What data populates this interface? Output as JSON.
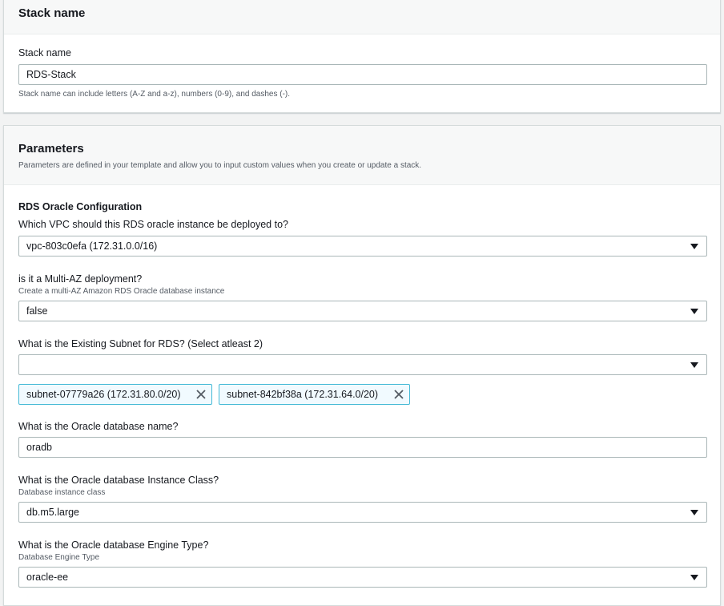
{
  "stack_section": {
    "title": "Stack name",
    "field_label": "Stack name",
    "field_value": "RDS-Stack",
    "hint": "Stack name can include letters (A-Z and a-z), numbers (0-9), and dashes (-)."
  },
  "params_section": {
    "title": "Parameters",
    "description": "Parameters are defined in your template and allow you to input custom values when you create or update a stack.",
    "group_title": "RDS Oracle Configuration",
    "vpc": {
      "label": "Which VPC should this RDS oracle instance be deployed to?",
      "value": "vpc-803c0efa (172.31.0.0/16)"
    },
    "multi_az": {
      "label": "is it a Multi-AZ deployment?",
      "hint": "Create a multi-AZ Amazon RDS Oracle database instance",
      "value": "false"
    },
    "subnets": {
      "label": "What is the Existing Subnet for RDS? (Select atleast 2)",
      "value": "",
      "tokens": [
        "subnet-07779a26 (172.31.80.0/20)",
        "subnet-842bf38a (172.31.64.0/20)"
      ]
    },
    "db_name": {
      "label": "What is the Oracle database name?",
      "value": "oradb"
    },
    "instance_class": {
      "label": "What is the Oracle database Instance Class?",
      "hint": "Database instance class",
      "value": "db.m5.large"
    },
    "engine_type": {
      "label": "What is the Oracle database Engine Type?",
      "hint": "Database Engine Type",
      "value": "oracle-ee"
    }
  },
  "icons": {
    "dropdown": "caret-down-icon",
    "remove": "close-icon"
  },
  "colors": {
    "token_border": "#44b9d6",
    "token_bg": "#f1faff",
    "field_border": "#aab7b8",
    "header_bg": "#f7f8f8"
  }
}
